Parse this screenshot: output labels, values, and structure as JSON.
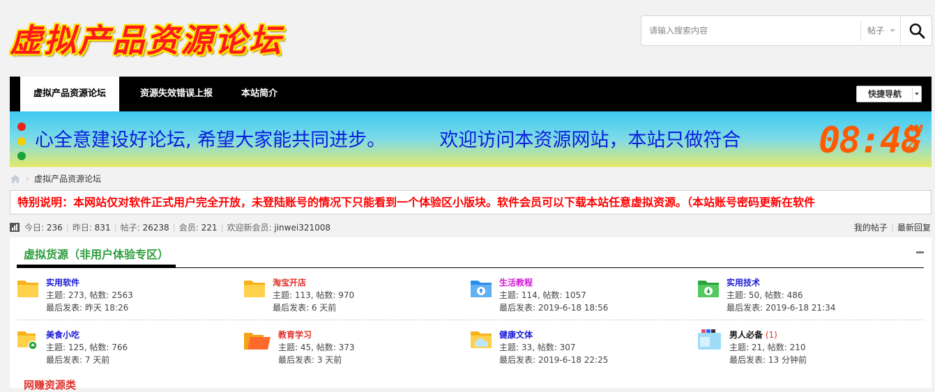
{
  "header": {
    "logo_text": "虚拟产品资源论坛",
    "search_placeholder": "请输入搜索内容",
    "search_type": "帖子"
  },
  "nav": {
    "items": [
      {
        "label": "虚拟产品资源论坛",
        "active": true
      },
      {
        "label": "资源失效错误上报",
        "active": false
      },
      {
        "label": "本站简介",
        "active": false
      }
    ],
    "quick_nav": "快捷导航"
  },
  "banner": {
    "marquee": "心全意建设好论坛, 希望大家能共同进步。         欢迎访问本资源网站，本站只做符合",
    "dots": [
      "#e8251a",
      "#f2d000",
      "#1aa53a"
    ],
    "clock_time": "08:48",
    "clock_ampm": "AM",
    "clock_seconds": "27"
  },
  "breadcrumb": {
    "current": "虚拟产品资源论坛"
  },
  "notice": "特别说明：本网站仅对软件正式用户完全开放，未登陆账号的情况下只能看到一个体验区小版块。软件会员可以下载本站任意虚拟资源。（本站账号密码更新在软件",
  "stats": {
    "today_label": "今日: ",
    "today": "236",
    "yesterday_label": "昨日: ",
    "yesterday": "831",
    "posts_label": "帖子: ",
    "posts": "26238",
    "members_label": "会员: ",
    "members": "221",
    "welcome_label": "欢迎新会员: ",
    "new_member": "jinwei321008",
    "my_posts": "我的帖子",
    "latest_replies": "最新回复"
  },
  "section": {
    "title": "虚拟货源（非用户体验专区）",
    "forums": [
      {
        "name": "实用软件",
        "name_color": "#1a1ad6",
        "badge": "",
        "stats": "主题: 273, 帖数: 2563",
        "last": "最后发表: 昨天 18:26",
        "icon": "folder-icon"
      },
      {
        "name": "淘宝开店",
        "name_color": "#e1322c",
        "badge": "",
        "stats": "主题: 113, 帖数: 970",
        "last": "最后发表: 6 天前",
        "icon": "folder-icon"
      },
      {
        "name": "生活教程",
        "name_color": "#d616d6",
        "badge": "",
        "stats": "主题: 114, 帖数: 1057",
        "last": "最后发表: 2019-6-18 18:56",
        "icon": "upload-folder-icon"
      },
      {
        "name": "实用技术",
        "name_color": "#1a1ad6",
        "badge": "",
        "stats": "主题: 50, 帖数: 486",
        "last": "最后发表: 2019-6-18 21:34",
        "icon": "download-folder-icon"
      },
      {
        "name": "美食小吃",
        "name_color": "#1a1ad6",
        "badge": "",
        "stats": "主题: 125, 帖数: 766",
        "last": "最后发表: 7 天前",
        "icon": "shared-folder-icon"
      },
      {
        "name": "教育学习",
        "name_color": "#e1322c",
        "badge": "",
        "stats": "主题: 45, 帖数: 373",
        "last": "最后发表: 3 天前",
        "icon": "orange-folder-icon"
      },
      {
        "name": "健康文体",
        "name_color": "#1a1ad6",
        "badge": "",
        "stats": "主题: 33, 帖数: 307",
        "last": "最后发表: 2019-6-18 22:25",
        "icon": "cloud-folder-icon"
      },
      {
        "name": "男人必备",
        "name_color": "#111111",
        "badge": " (1)",
        "stats": "主题: 21, 帖数: 210",
        "last": "最后发表: 13 分钟前",
        "icon": "files-icon"
      }
    ],
    "next_title": "网赚资源类"
  }
}
